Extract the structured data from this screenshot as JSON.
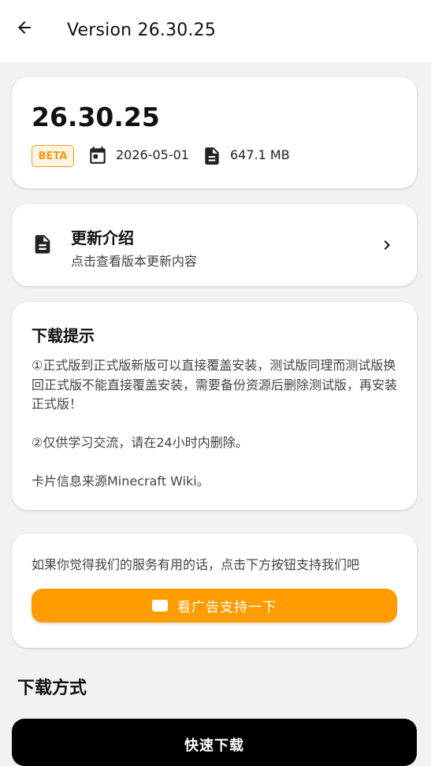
{
  "header": {
    "title": "Version 26.30.25",
    "back_icon": "arrow-left-icon"
  },
  "version_card": {
    "version": "26.30.25",
    "badge": "BETA",
    "date_icon": "calendar-icon",
    "date": "2026-05-01",
    "size_icon": "file-icon",
    "size": "647.1 MB"
  },
  "notes_card": {
    "icon": "document-icon",
    "title": "更新介绍",
    "subtitle": "点击查看版本更新内容",
    "chevron_icon": "chevron-right-icon"
  },
  "tips_card": {
    "title": "下载提示",
    "paragraph1": "①正式版到正式版新版可以直接覆盖安装，测试版同理而测试版换回正式版不能直接覆盖安装，需要备份资源后删除测试版，再安装正式版！",
    "paragraph2": "②仅供学习交流，请在24小时内删除。",
    "paragraph3": "卡片信息来源Minecraft Wiki。"
  },
  "support_card": {
    "text": "如果你觉得我们的服务有用的话，点击下方按钮支持我们吧",
    "button_icon": "ad-icon",
    "button_label": "看广告支持一下"
  },
  "download": {
    "section_title": "下载方式",
    "fast_label": "快速下载"
  },
  "colors": {
    "accent": "#ff9c00",
    "badge_border": "#f0a020",
    "badge_text": "#f39a12",
    "badge_bg": "#fff4e0",
    "background": "#f2f2f2",
    "card": "#ffffff",
    "download_button": "#000000"
  }
}
